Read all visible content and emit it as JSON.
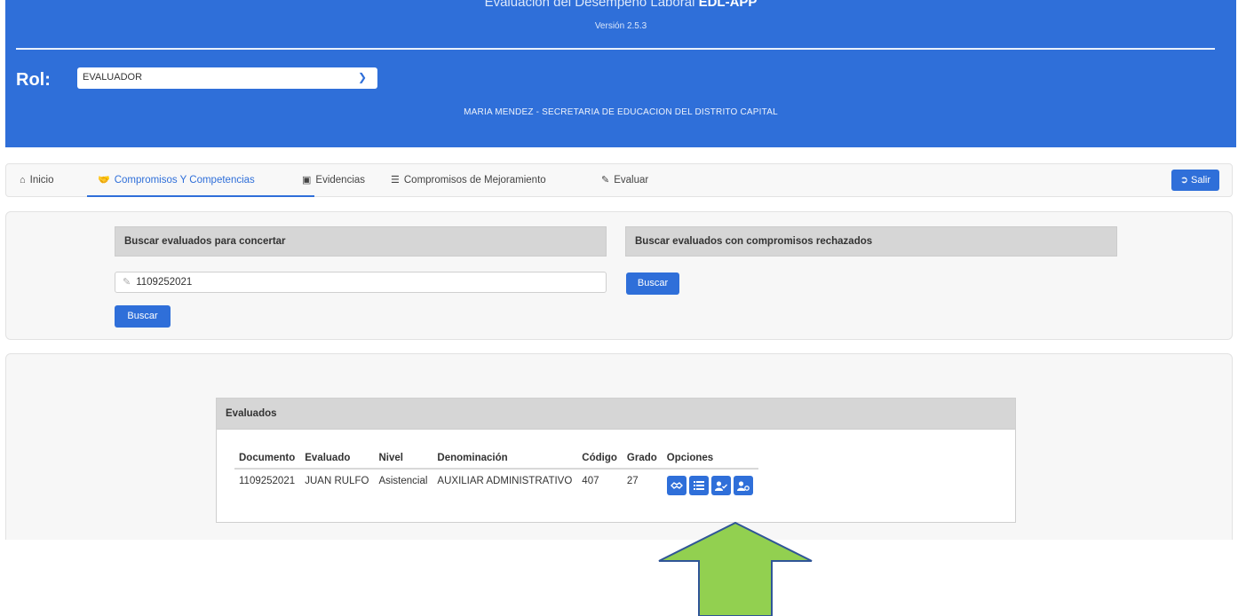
{
  "header": {
    "title_prefix": "Evaluación del Desempeño Laboral ",
    "title_bold": "EDL-APP",
    "version": "Versión 2.5.3",
    "rol_label": "Rol:",
    "rol_value": "EVALUADOR",
    "user_line": "MARIA MENDEZ - SECRETARIA DE EDUCACION DEL DISTRITO CAPITAL"
  },
  "nav": {
    "items": [
      {
        "label": "Inicio",
        "icon": "home-icon"
      },
      {
        "label": "Compromisos Y Competencias",
        "icon": "handshake-icon",
        "active": true
      },
      {
        "label": "Evidencias",
        "icon": "save-icon"
      },
      {
        "label": "Compromisos de Mejoramiento",
        "icon": "list-icon"
      },
      {
        "label": "Evaluar",
        "icon": "edit-icon"
      }
    ],
    "salir_label": "Salir"
  },
  "search": {
    "concertar_heading": "Buscar evaluados para concertar",
    "rechazados_heading": "Buscar evaluados con compromisos rechazados",
    "document_value": "1109252021",
    "buscar_label": "Buscar",
    "buscar_rechazados_label": "Buscar"
  },
  "evaluados": {
    "heading": "Evaluados",
    "columns": [
      "Documento",
      "Evaluado",
      "Nivel",
      "Denominación",
      "Código",
      "Grado",
      "Opciones"
    ],
    "rows": [
      [
        "1109252021",
        "JUAN RULFO",
        "Asistencial",
        "AUXILIAR ADMINISTRATIVO",
        "407",
        "27"
      ]
    ],
    "option_icons": [
      "handshake-icon",
      "list-icon",
      "user-check-icon",
      "user-gear-icon"
    ]
  },
  "colors": {
    "primary": "#2f6fd9",
    "arrow_fill": "#92d050",
    "arrow_stroke": "#2f5597"
  }
}
